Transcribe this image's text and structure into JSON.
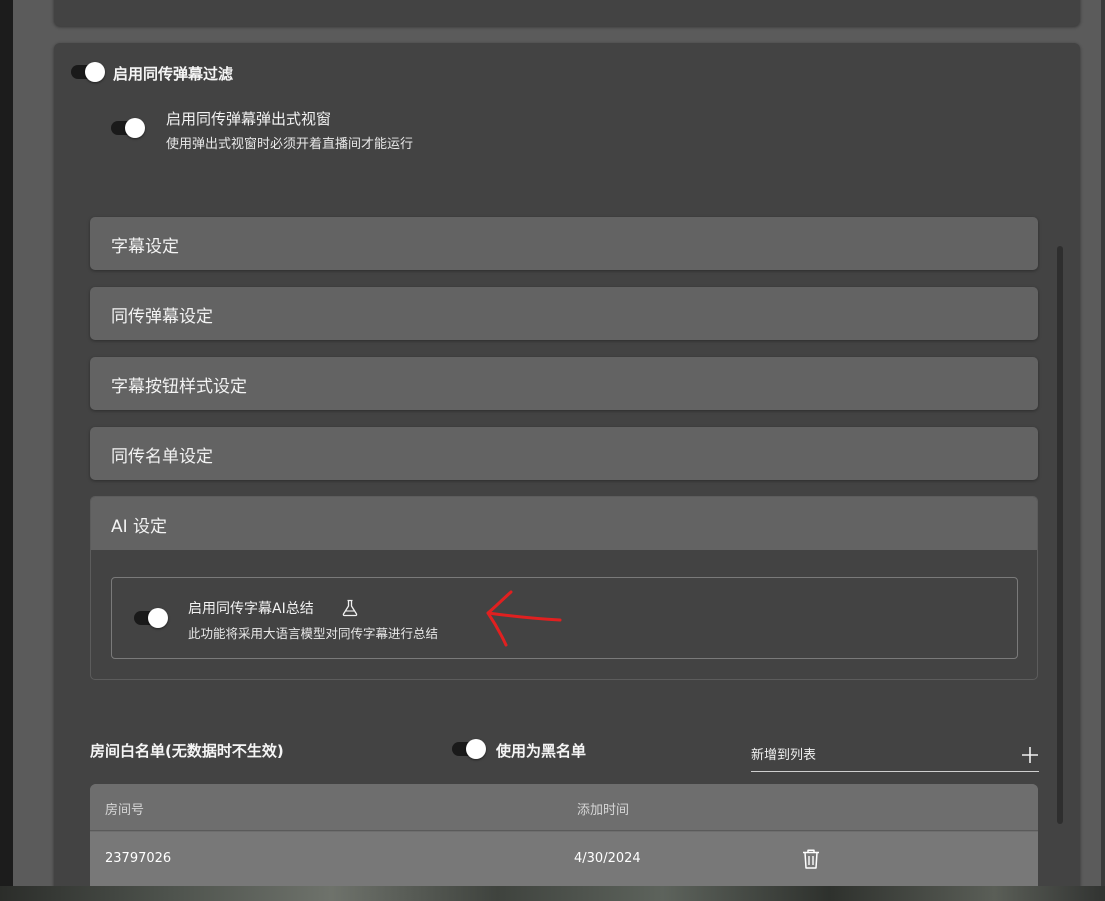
{
  "filter_toggle": {
    "label": "启用同传弹幕过滤",
    "on": true
  },
  "popup_toggle": {
    "label": "启用同传弹幕弹出式视窗",
    "description": "使用弹出式视窗时必须开着直播间才能运行",
    "on": true
  },
  "sections": [
    {
      "label": "字幕设定"
    },
    {
      "label": "同传弹幕设定"
    },
    {
      "label": "字幕按钮样式设定"
    },
    {
      "label": "同传名单设定"
    }
  ],
  "ai_section": {
    "label": "AI 设定",
    "summary_toggle": {
      "label": "启用同传字幕AI总结",
      "description": "此功能将采用大语言模型对同传字幕进行总结",
      "on": true,
      "icon": "flask-icon"
    }
  },
  "whitelist": {
    "title": "房间白名单(无数据时不生效)",
    "blacklist_toggle": {
      "label": "使用为黑名单",
      "on": true
    },
    "add_field": {
      "label": "新增到列表",
      "icon": "plus-icon"
    },
    "columns": [
      "房间号",
      "添加时间"
    ],
    "rows": [
      {
        "room": "23797026",
        "added": "4/30/2024",
        "action_icon": "trash-icon"
      }
    ]
  },
  "colors": {
    "card": "#434343",
    "accordion": "#636363",
    "annotation_arrow": "#e02020"
  }
}
